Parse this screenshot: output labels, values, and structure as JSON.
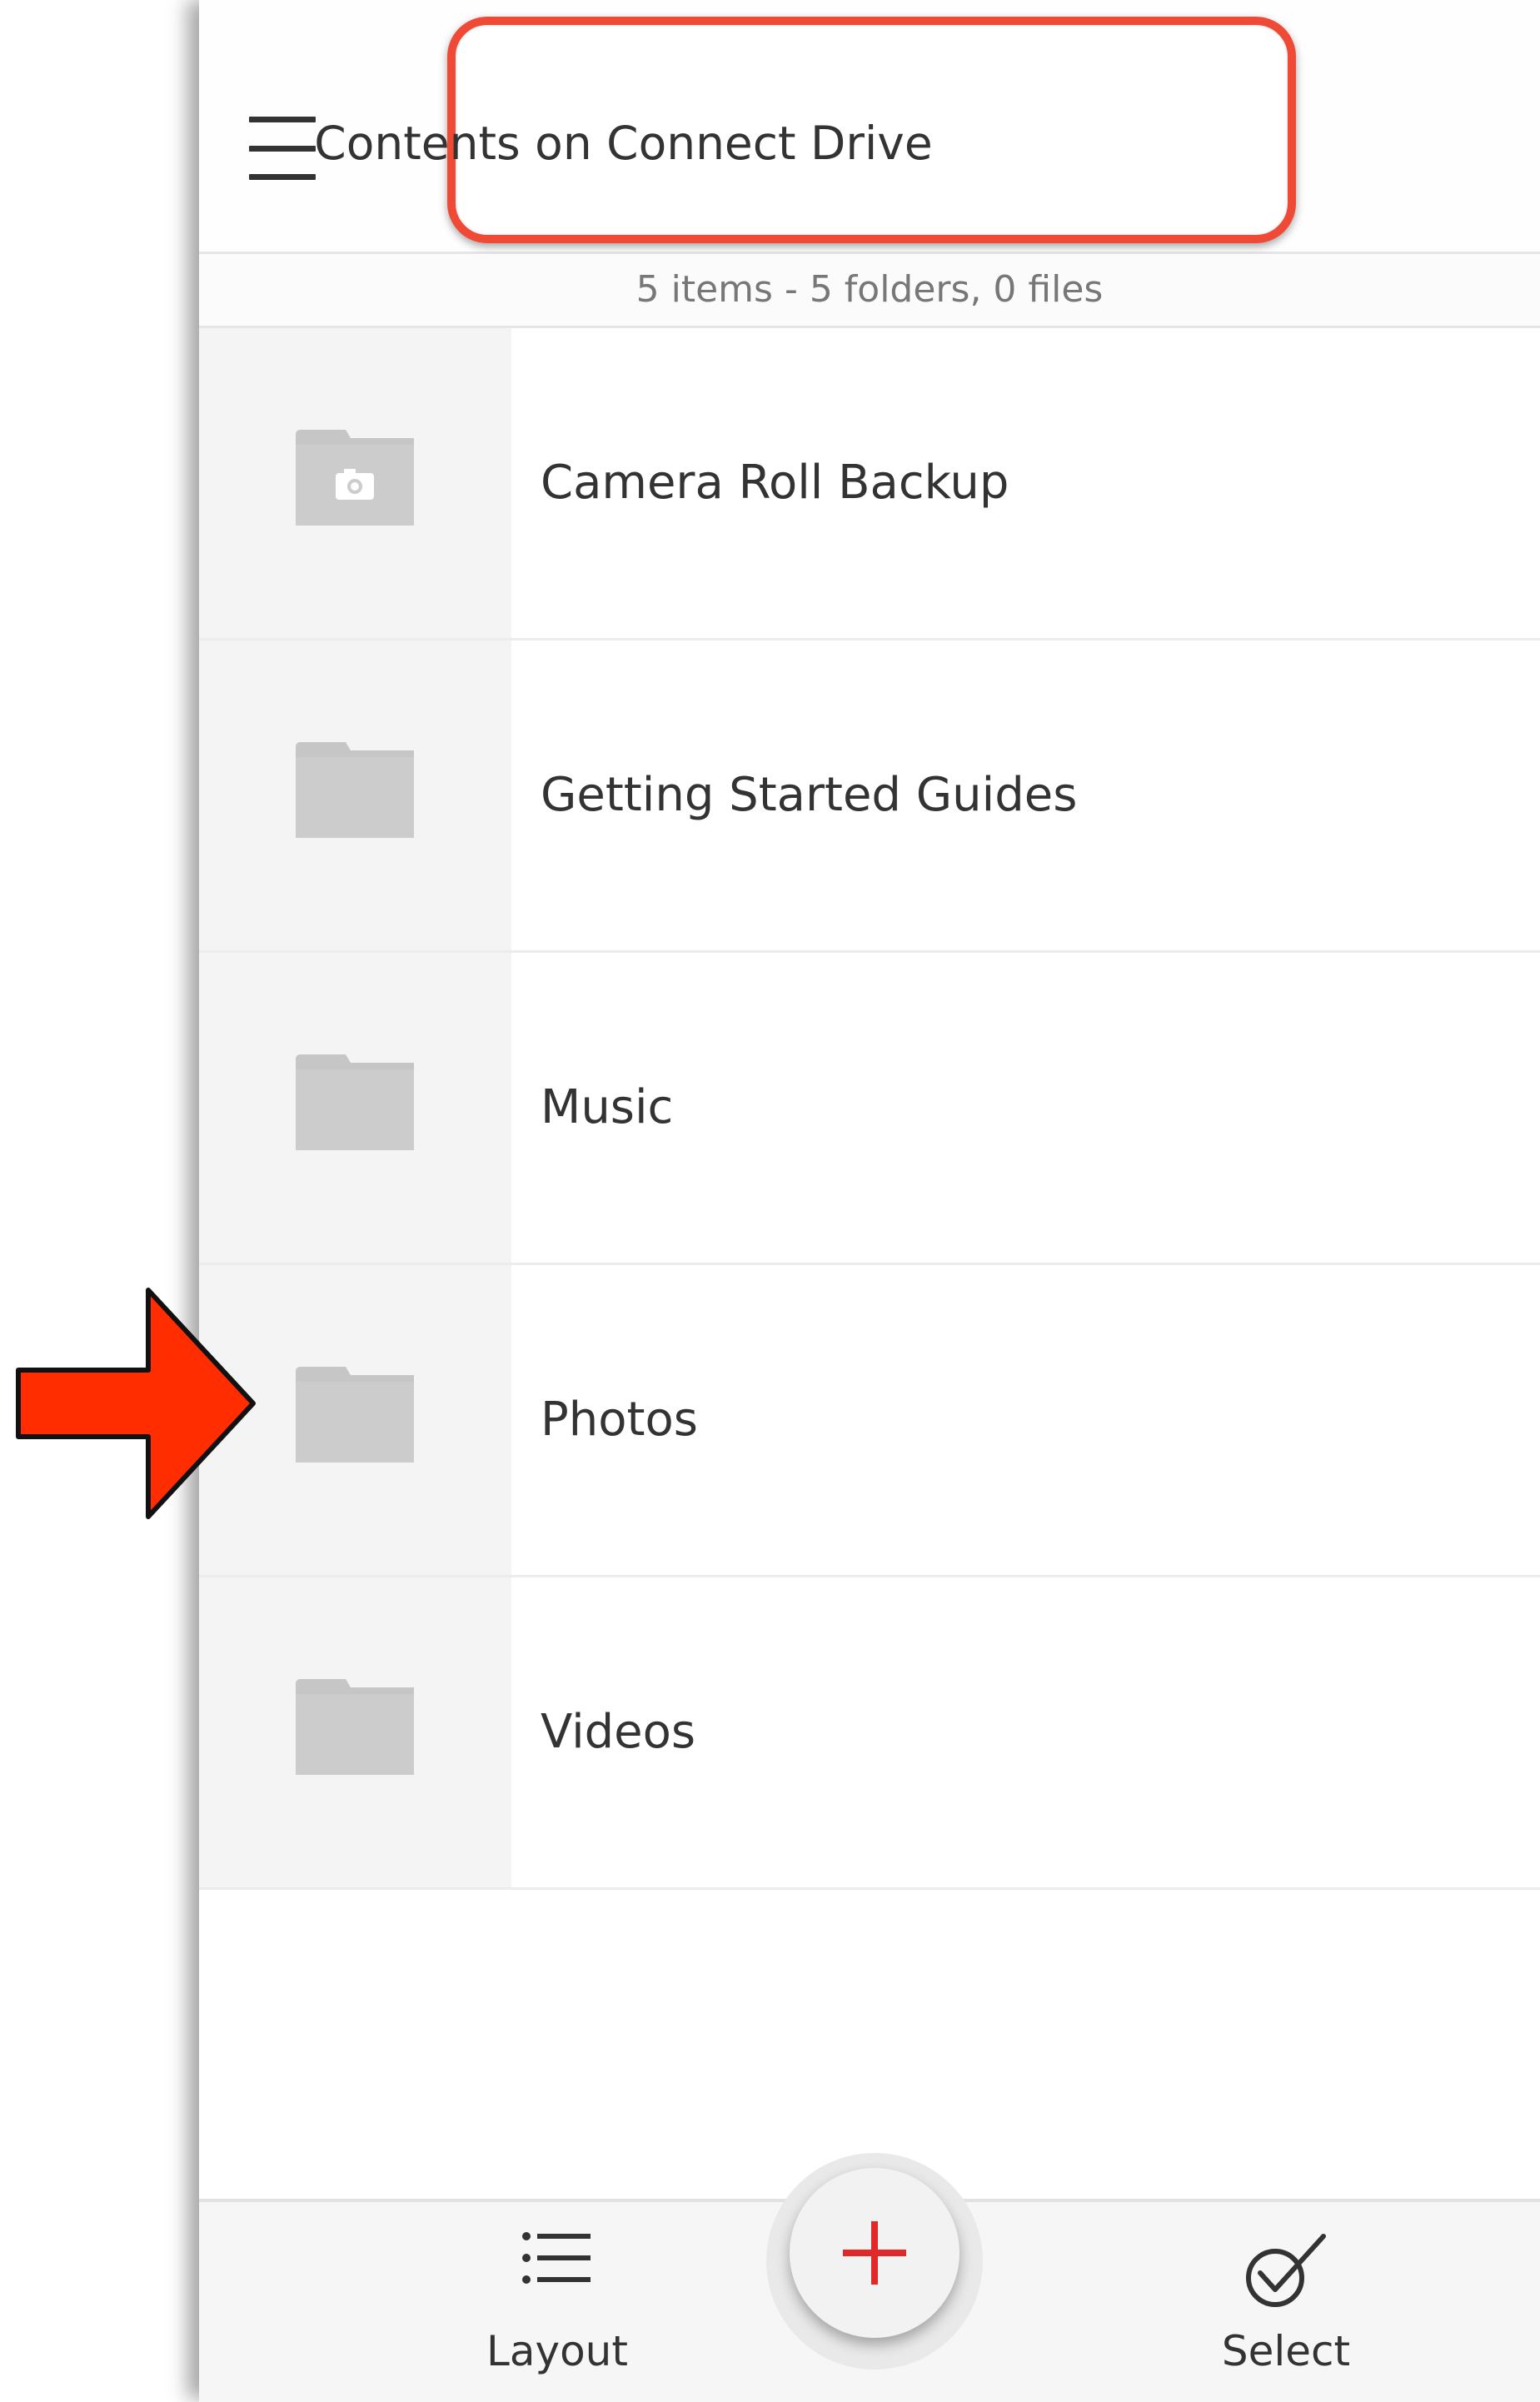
{
  "header": {
    "title": "Contents on Connect Drive"
  },
  "summary": "5 items - 5 folders, 0 files",
  "folders": [
    {
      "label": "Camera Roll Backup",
      "icon": "camera-folder-icon"
    },
    {
      "label": "Getting Started Guides",
      "icon": "folder-icon"
    },
    {
      "label": "Music",
      "icon": "folder-icon"
    },
    {
      "label": "Photos",
      "icon": "folder-icon"
    },
    {
      "label": "Videos",
      "icon": "folder-icon"
    }
  ],
  "bottombar": {
    "layout_label": "Layout",
    "select_label": "Select",
    "add_icon": "plus-icon"
  },
  "colors": {
    "highlight": "#ef4a35",
    "arrow": "#ff2d00",
    "add_plus": "#e02a2a",
    "folder": "#c8c8c8"
  }
}
